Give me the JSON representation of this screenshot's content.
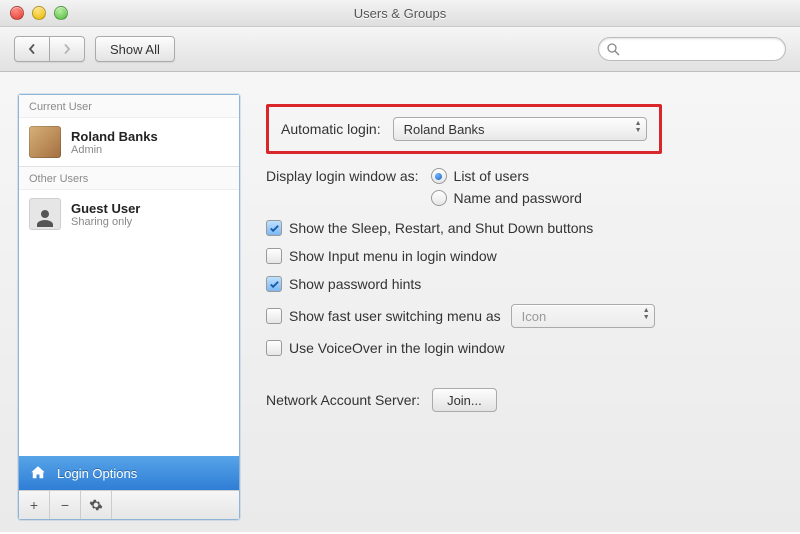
{
  "window": {
    "title": "Users & Groups"
  },
  "toolbar": {
    "show_all": "Show All",
    "search_placeholder": ""
  },
  "sidebar": {
    "section_current": "Current User",
    "section_other": "Other Users",
    "current": {
      "name": "Roland Banks",
      "role": "Admin"
    },
    "other": [
      {
        "name": "Guest User",
        "role": "Sharing only"
      }
    ],
    "login_options": "Login Options"
  },
  "main": {
    "auto_login_label": "Automatic login:",
    "auto_login_value": "Roland Banks",
    "display_label": "Display login window as:",
    "radio_list": "List of users",
    "radio_namepw": "Name and password",
    "display_selected": "list",
    "cb_sleep": "Show the Sleep, Restart, and Shut Down buttons",
    "cb_input": "Show Input menu in login window",
    "cb_hints": "Show password hints",
    "cb_fastswitch": "Show fast user switching menu as",
    "fastswitch_value": "Icon",
    "cb_voiceover": "Use VoiceOver in the login window",
    "checked": {
      "sleep": true,
      "input": false,
      "hints": true,
      "fastswitch": false,
      "voiceover": false
    },
    "nas_label": "Network Account Server:",
    "join_label": "Join..."
  }
}
